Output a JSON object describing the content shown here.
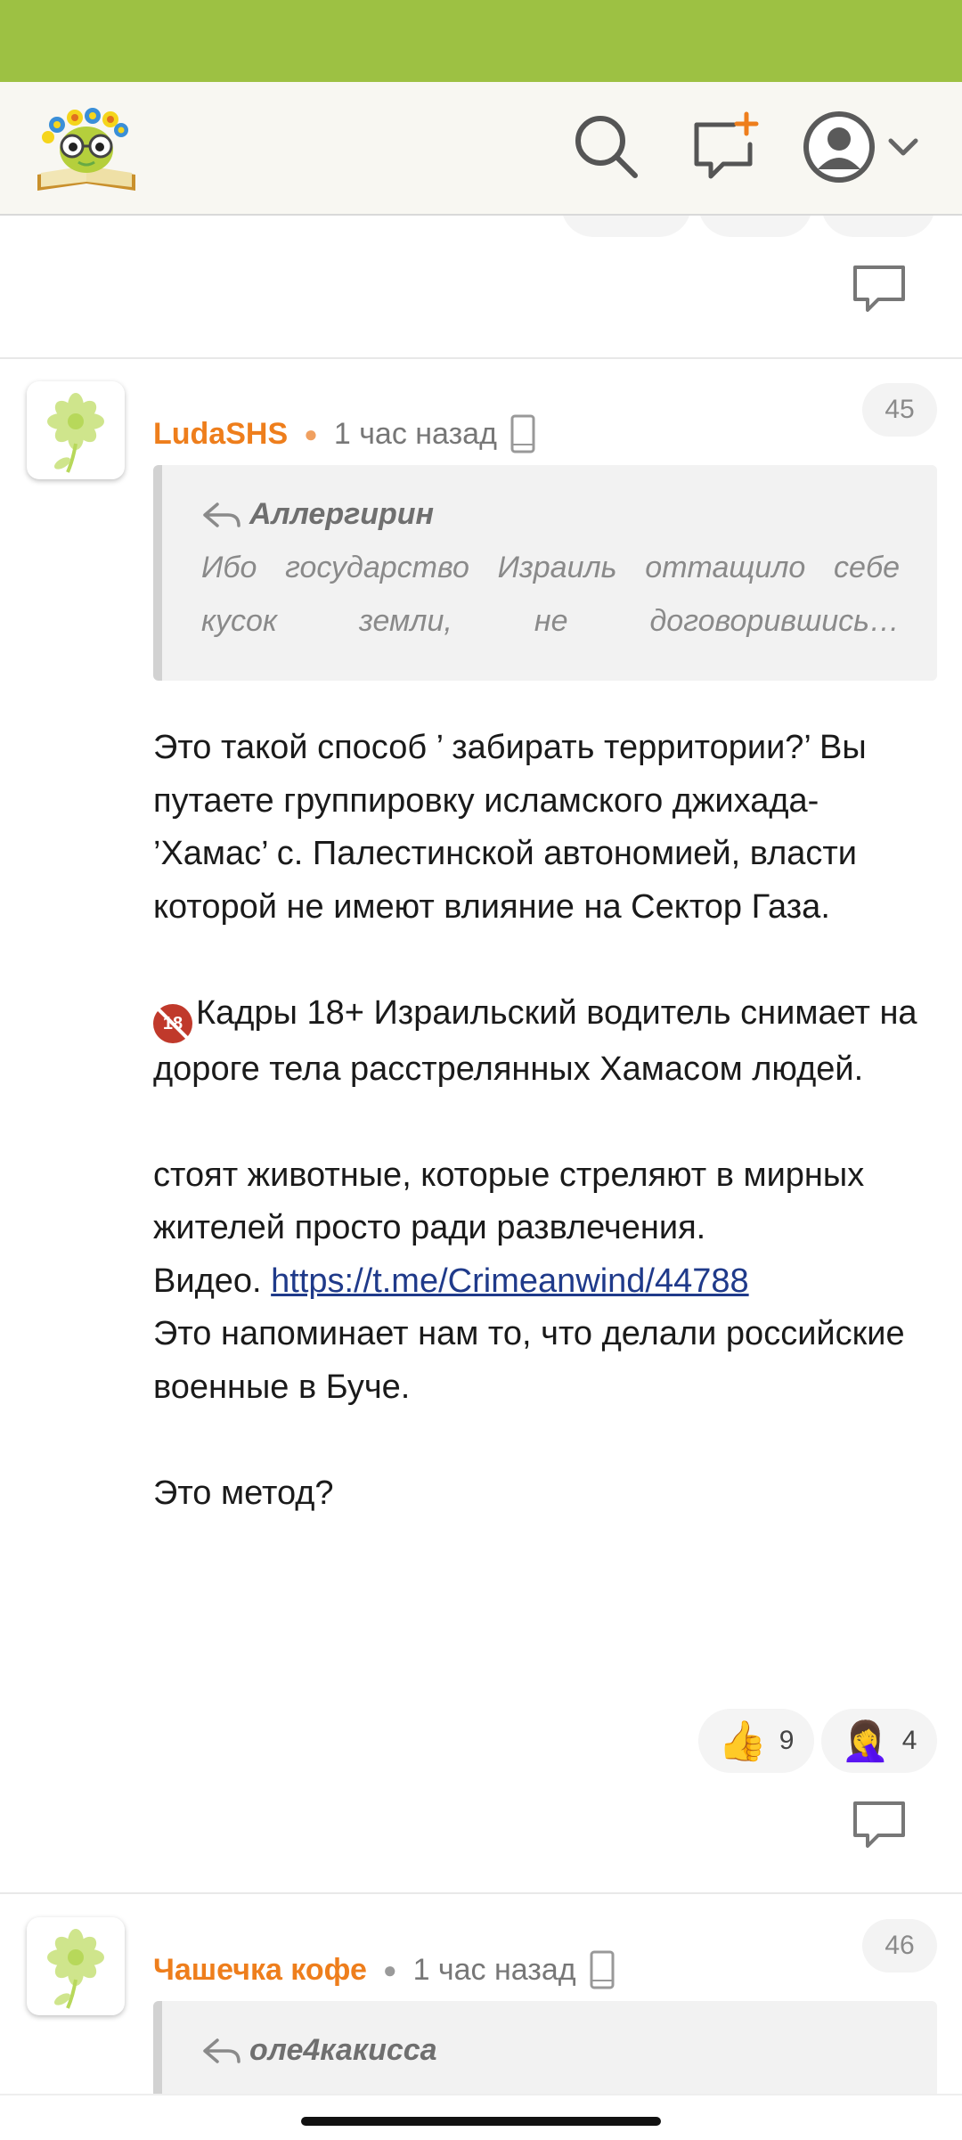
{
  "header": {
    "logo_name": "site-logo",
    "icons": [
      "search-icon",
      "new-post-icon",
      "user-avatar-icon",
      "chevron-down-icon"
    ]
  },
  "previous_comment": {
    "reply_icon": "reply-icon"
  },
  "comments": [
    {
      "author": "LudaSHS",
      "time": "1 час назад",
      "number": "45",
      "quote_author": "Аллергирин",
      "quote_text": "Ибо государство Израиль оттащило себе кусок земли, не договорившись…",
      "paragraphs": {
        "p1": "Это такой способ ’ забирать территории?’ Вы путаете группировку исламского джихада- ’Хамас’ с. Палестинской автономией, власти которой не имеют влияние на Сектор Газа.",
        "p2": "Кадры 18+ Израильский водитель снимает на дороге тела расстрелянных Хамасом людей.",
        "p3_line1": "стоят животные, которые стреляют в мирных жителей просто ради развлечения.",
        "p3_video_label": "Видео.",
        "p3_link": "https://t.me/Crimeanwind/44788",
        "p3_line2": "Это напоминает нам то, что делали российские военные в Буче.",
        "p4": "Это метод?"
      },
      "reactions": [
        {
          "emoji": "👍",
          "count": "9"
        },
        {
          "emoji": "🤦‍♀️",
          "count": "4"
        }
      ]
    },
    {
      "author": "Чашечка кофе",
      "time": "1 час назад",
      "number": "46",
      "quote_author": "оле4какисса"
    }
  ],
  "colors": {
    "status_bar": "#9dc143",
    "author": "#ee7e1c",
    "link": "#1f3a8a"
  }
}
